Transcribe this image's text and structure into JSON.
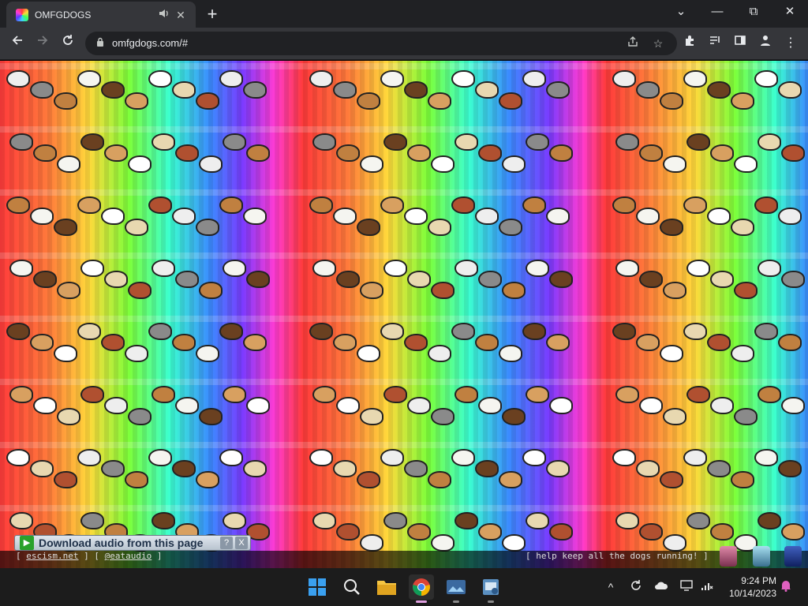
{
  "browser": {
    "tab_title": "OMFGDOGS",
    "tab_audio_icon": "speaker-icon",
    "url": "omfgdogs.com/#",
    "new_tab_symbol": "+",
    "window_controls": [
      "⌄",
      "—",
      "⧉",
      "✕"
    ]
  },
  "page": {
    "download_label": "Download audio from this page",
    "download_help": "?",
    "download_close": "X",
    "footer_bracket_open": "[ ",
    "footer_link1": "escism.net",
    "footer_mid": " ] [ ",
    "footer_link2": "@eataudio",
    "footer_bracket_close": " ]",
    "footer_right": "[ help keep all the dogs running! ]"
  },
  "taskbar": {
    "apps": [
      "windows-start",
      "search",
      "file-explorer",
      "chrome",
      "photos",
      "control-panel"
    ],
    "clock_time": "9:24 PM",
    "clock_date": "10/14/2023"
  },
  "colors": {
    "chrome_dark": "#202124",
    "chrome_toolbar": "#35363a",
    "taskbar": "#1c1c1c"
  }
}
